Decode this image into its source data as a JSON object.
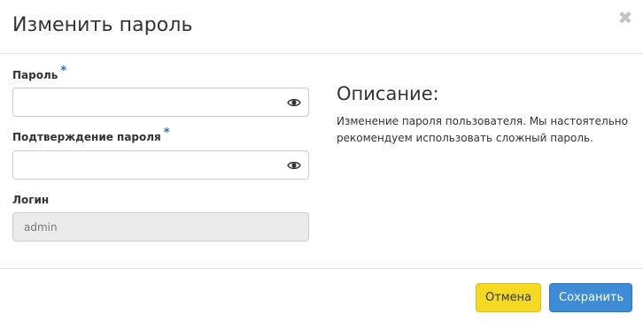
{
  "modal": {
    "title": "Изменить пароль",
    "close_glyph": "✖"
  },
  "form": {
    "password": {
      "label": "Пароль",
      "required_mark": "*",
      "value": "",
      "icon": "eye-icon"
    },
    "confirm_password": {
      "label": "Подтверждение пароля",
      "required_mark": "*",
      "value": "",
      "icon": "eye-icon"
    },
    "login": {
      "label": "Логин",
      "value": "admin"
    }
  },
  "description": {
    "title": "Описание:",
    "text": "Изменение пароля пользователя. Мы настоятельно рекомендуем использовать сложный пароль."
  },
  "footer": {
    "cancel_label": "Отмена",
    "save_label": "Сохранить"
  },
  "colors": {
    "required": "#1b73c5",
    "cancel_button": "#f5d922",
    "save_button": "#3e8bd6"
  }
}
